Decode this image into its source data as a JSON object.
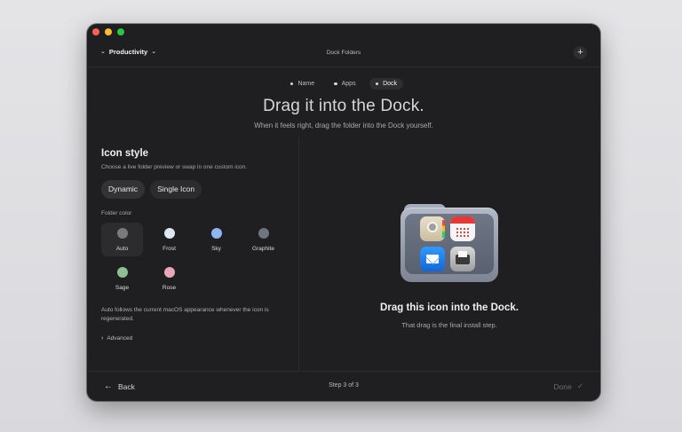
{
  "window": {
    "title": "Dock Folders",
    "collection_name": "Productivity",
    "add_label": "+"
  },
  "steps": [
    {
      "label": "Name",
      "active": false
    },
    {
      "label": "Apps",
      "active": false
    },
    {
      "label": "Dock",
      "active": true
    }
  ],
  "hero": {
    "title": "Drag it into the Dock.",
    "subtitle": "When it feels right, drag the folder into the Dock yourself."
  },
  "icon_style": {
    "title": "Icon style",
    "description": "Choose a live folder preview or swap in one custom icon.",
    "modes": [
      {
        "label": "Dynamic",
        "selected": true
      },
      {
        "label": "Single Icon",
        "selected": false
      }
    ],
    "folder_color_label": "Folder color",
    "colors": [
      {
        "name": "Auto",
        "hex": "#7a7a7c",
        "selected": true
      },
      {
        "name": "Frost",
        "hex": "#dfe7f2",
        "selected": false
      },
      {
        "name": "Sky",
        "hex": "#8fb6f0",
        "selected": false
      },
      {
        "name": "Graphite",
        "hex": "#70747c",
        "selected": false
      },
      {
        "name": "Sage",
        "hex": "#8fbf92",
        "selected": false
      },
      {
        "name": "Rose",
        "hex": "#e9a7b8",
        "selected": false
      }
    ],
    "note": "Auto follows the current macOS appearance whenever the icon is regenerated.",
    "advanced_label": "Advanced"
  },
  "preview": {
    "apps": [
      "contacts-icon",
      "calendar-icon",
      "mail-icon",
      "printer-icon"
    ],
    "title": "Drag this icon into the Dock.",
    "subtitle": "That drag is the final install step."
  },
  "footer": {
    "back_label": "Back",
    "step_text": "Step 3 of 3",
    "done_label": "Done"
  }
}
